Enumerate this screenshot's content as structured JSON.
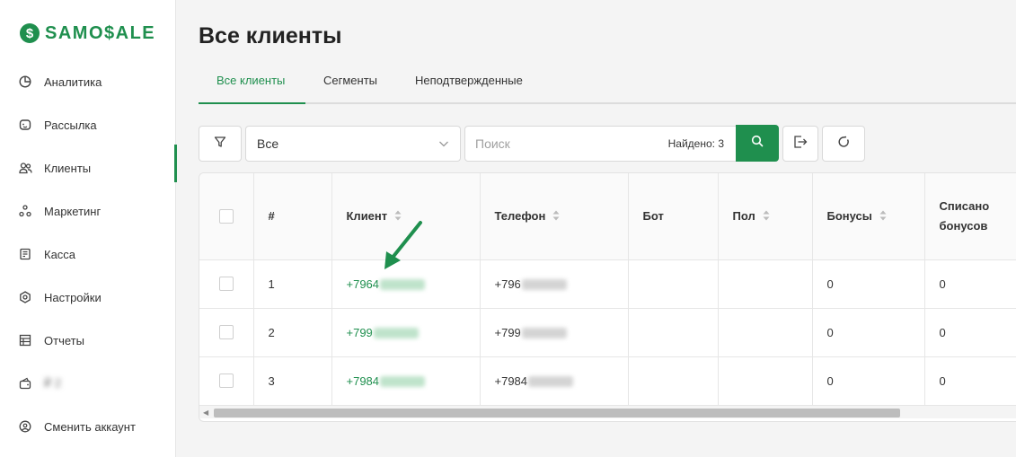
{
  "brand": {
    "logo_text": "SAMO$ALE",
    "logo_mark": "$"
  },
  "sidebar": {
    "items": [
      {
        "label": "Аналитика",
        "icon": "analytics-icon"
      },
      {
        "label": "Рассылка",
        "icon": "mailing-icon"
      },
      {
        "label": "Клиенты",
        "icon": "clients-icon",
        "active": true
      },
      {
        "label": "Маркетинг",
        "icon": "marketing-icon"
      },
      {
        "label": "Касса",
        "icon": "cashbox-icon"
      },
      {
        "label": "Настройки",
        "icon": "settings-icon"
      },
      {
        "label": "Отчеты",
        "icon": "reports-icon"
      },
      {
        "label": "₽ 2",
        "icon": "wallet-icon"
      },
      {
        "label": "Сменить аккаунт",
        "icon": "switch-account-icon"
      }
    ]
  },
  "page": {
    "title": "Все клиенты"
  },
  "tabs": [
    {
      "label": "Все клиенты",
      "active": true
    },
    {
      "label": "Сегменты"
    },
    {
      "label": "Неподтвержденные"
    }
  ],
  "toolbar": {
    "filter_select_value": "Все",
    "search_placeholder": "Поиск",
    "found_label": "Найдено: 3"
  },
  "table": {
    "columns": [
      "#",
      "Клиент",
      "Телефон",
      "Бот",
      "Пол",
      "Бонусы",
      "Списано бонусов"
    ],
    "rows": [
      {
        "num": "1",
        "client": "+7964",
        "phone": "+796",
        "bot": "",
        "gender": "",
        "bonuses": "0",
        "written_off": "0"
      },
      {
        "num": "2",
        "client": "+799",
        "phone": "+799",
        "bot": "",
        "gender": "",
        "bonuses": "0",
        "written_off": "0"
      },
      {
        "num": "3",
        "client": "+7984",
        "phone": "+7984",
        "bot": "",
        "gender": "",
        "bonuses": "0",
        "written_off": "0"
      }
    ]
  },
  "colors": {
    "accent": "#1f8f4e"
  }
}
